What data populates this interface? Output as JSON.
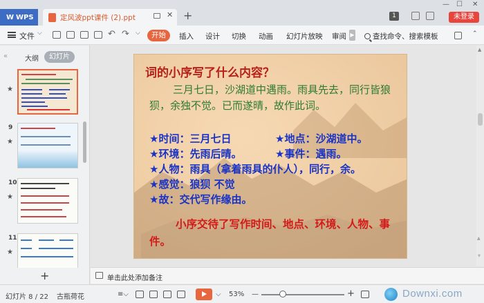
{
  "titlebar": {
    "app_tab": "WPS",
    "doc_tab_title": "定风波ppt课件 (2).ppt",
    "login_button": "未登录",
    "badge": "1"
  },
  "menubar": {
    "file": "文件",
    "start": "开始",
    "items": [
      "插入",
      "设计",
      "切换",
      "动画",
      "幻灯片放映",
      "审阅"
    ],
    "search": "查找命令、搜索模板"
  },
  "leftpanel": {
    "tab_outline": "大纲",
    "tab_slides": "幻灯片",
    "thumbnails": [
      {
        "number": "",
        "active": true
      },
      {
        "number": "9",
        "active": false
      },
      {
        "number": "10",
        "active": false
      },
      {
        "number": "11",
        "active": false
      }
    ]
  },
  "slide": {
    "title": "词的小序写了什么内容？",
    "paragraph": "三月七日，沙湖道中遇雨。雨具先去，同行皆狼狈，余独不觉。已而遂晴，故作此词。",
    "bullets": [
      "★时间：三月七日",
      "★地点：沙湖道中。",
      "★环境：先雨后晴。",
      "★事件：遇雨。",
      "★人物：雨具（拿着雨具的仆人），同行，余。",
      "★感觉：狼狈  不觉",
      "★故：交代写作缘由。"
    ],
    "conclusion": "小序交待了写作时间、地点、环境、人物、事件。"
  },
  "notes": {
    "placeholder": "单击此处添加备注"
  },
  "status": {
    "slide_counter": "幻灯片 8 / 22",
    "theme": "古瓶荷花",
    "zoom": "53%",
    "watermark": "Downxi.com"
  },
  "colors": {
    "accent": "#e8663f",
    "title_red": "#b8201a",
    "para_green": "#2f7a34",
    "bullet_blue": "#1a33c4",
    "conclusion_red": "#d21a1a",
    "wps_blue": "#3d6cc5",
    "login_red": "#e8453c"
  }
}
